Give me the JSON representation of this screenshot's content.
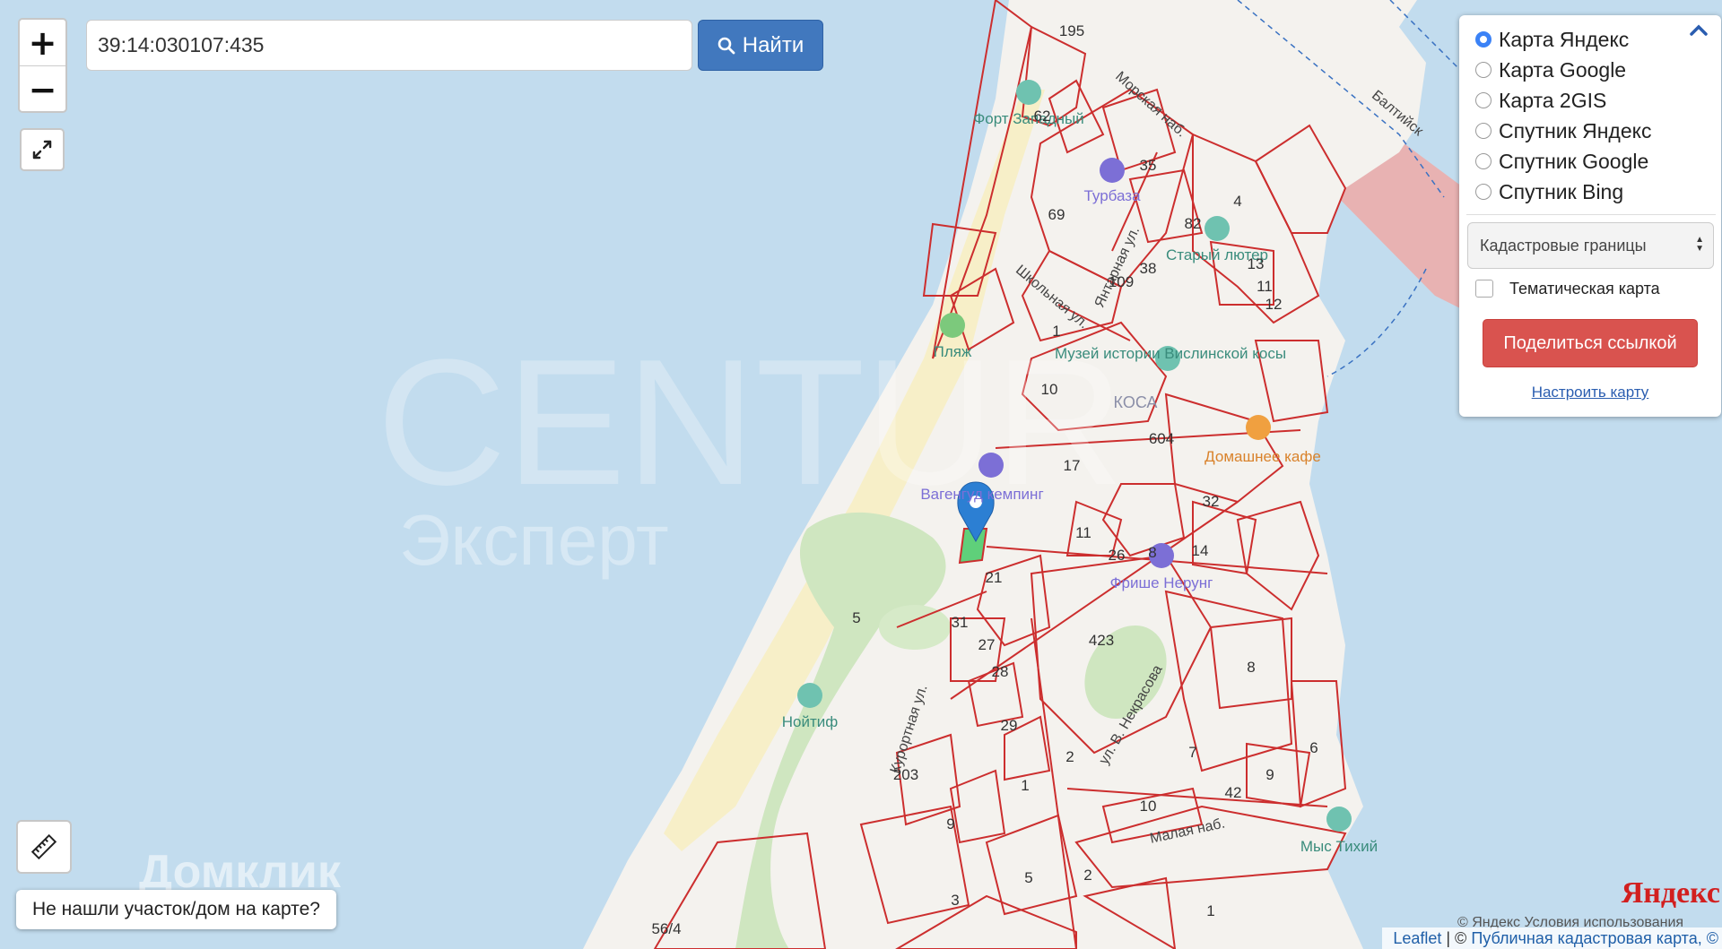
{
  "search": {
    "value": "39:14:030107:435",
    "button_label": "Найти"
  },
  "zoom": {
    "in_label": "+",
    "out_label": "−"
  },
  "layers": {
    "options": [
      {
        "label": "Карта Яндекс",
        "selected": true
      },
      {
        "label": "Карта Google",
        "selected": false
      },
      {
        "label": "Карта 2GIS",
        "selected": false
      },
      {
        "label": "Спутник Яндекс",
        "selected": false
      },
      {
        "label": "Спутник Google",
        "selected": false
      },
      {
        "label": "Спутник Bing",
        "selected": false
      }
    ],
    "overlay_select": "Кадастровые границы",
    "thematic_label": "Тематическая карта",
    "share_label": "Поделиться ссылкой",
    "configure_label": "Настроить карту"
  },
  "not_found_label": "Не нашли участок/дом на карте?",
  "attribution": {
    "leaflet": "Leaflet",
    "separator": " | © ",
    "cadastre": "Публичная кадастровая карта, ©"
  },
  "yandex": {
    "logo": "Яндекс",
    "terms": "© Яндекс  Условия использования"
  },
  "watermarks": {
    "centur": "CENTUR",
    "expert": "Эксперт",
    "domclick": "Домклик"
  },
  "map_labels": {
    "pois": [
      "Форт Западный",
      "Турбаза",
      "Старый лютер",
      "Пляж",
      "Музей истории Вислинской косы",
      "Домашнее кафе",
      "Вагенгуд кемпинг",
      "Фрише Нерунг",
      "Нойтиф",
      "Мыс Тихий"
    ],
    "streets": [
      "Морская наб.",
      "Янтарная ул.",
      "Школьная ул.",
      "Курортная ул.",
      "ул. В. Некрасова",
      "Малая наб.",
      "Балтийск"
    ],
    "district": "КОСА",
    "parcels": [
      "195",
      "62",
      "35",
      "69",
      "38",
      "109",
      "82",
      "4",
      "13",
      "11",
      "12",
      "1",
      "10",
      "17",
      "604",
      "32",
      "11",
      "26",
      "8",
      "14",
      "21",
      "31",
      "27",
      "28",
      "29",
      "423",
      "8",
      "5",
      "203",
      "9",
      "2",
      "1",
      "7",
      "6",
      "42",
      "9",
      "10",
      "5",
      "3",
      "56/4",
      "1",
      "2"
    ]
  },
  "colors": {
    "water": "#c2dcee",
    "land": "#f3f1ec",
    "parcel": "#cc2e2e",
    "button": "#4178be",
    "share": "#d9534f",
    "fairway": "#e7b1b1"
  }
}
